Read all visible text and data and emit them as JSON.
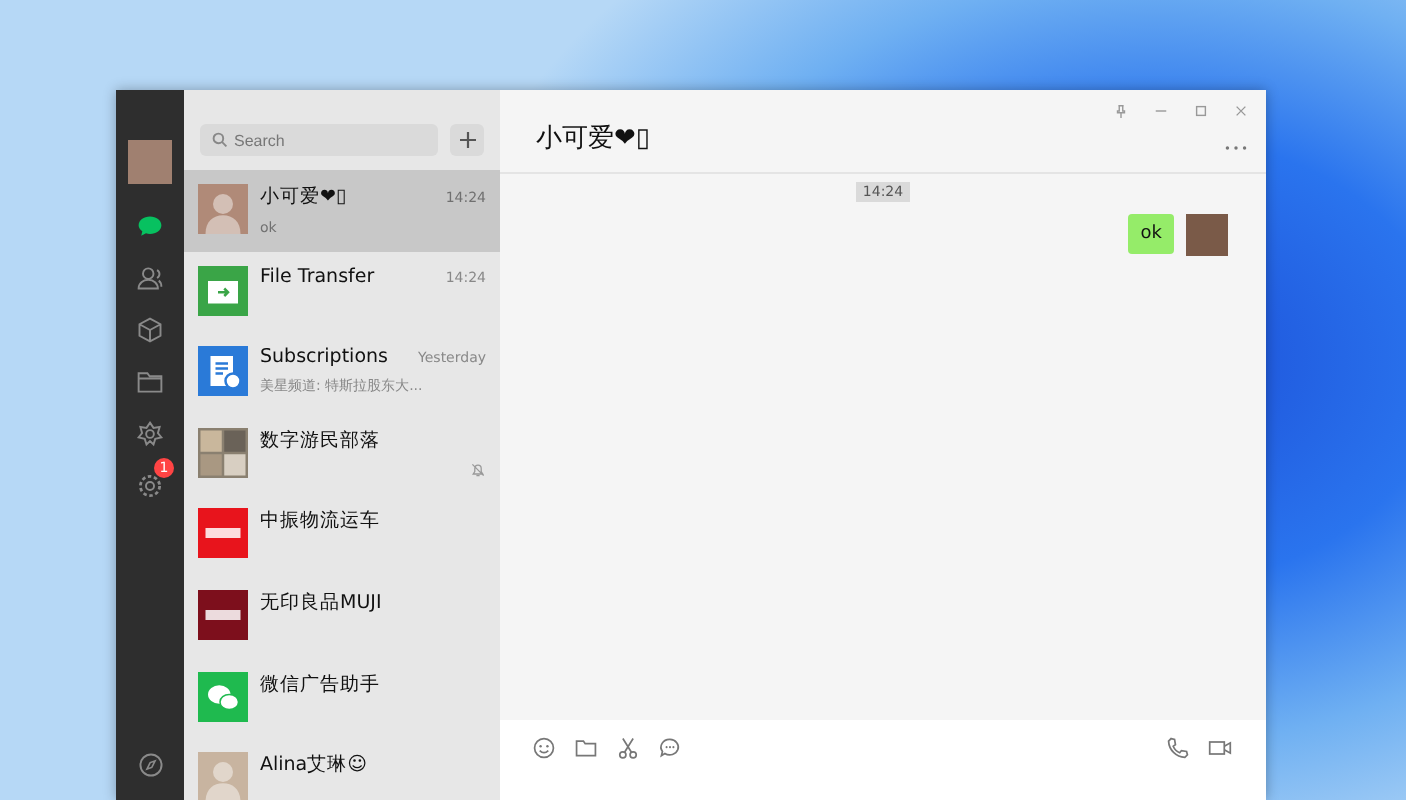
{
  "window": {
    "title": "小可爱❤▯"
  },
  "sidebar": {
    "items": [
      {
        "kind": "chats",
        "selected": true
      },
      {
        "kind": "contacts",
        "selected": false
      },
      {
        "kind": "cube",
        "selected": false
      },
      {
        "kind": "folder",
        "selected": false
      },
      {
        "kind": "flower",
        "selected": false
      },
      {
        "kind": "settings",
        "selected": false,
        "badge": "1"
      }
    ]
  },
  "search": {
    "placeholder": "Search"
  },
  "chats": [
    {
      "name": "小可爱❤▯",
      "preview": "ok",
      "time": "14:24",
      "selected": true,
      "muted": false,
      "kind": "photo",
      "color": "#b08a78"
    },
    {
      "name": "File Transfer",
      "time": "14:24",
      "selected": false,
      "muted": false,
      "kind": "file",
      "color": "#3aa547"
    },
    {
      "name": "Subscriptions",
      "preview": "美星频道: 特斯拉股东大...",
      "time": "Yesterday",
      "selected": false,
      "muted": false,
      "kind": "doc",
      "color": "#2a7ad8"
    },
    {
      "name": "数字游民部落",
      "selected": false,
      "muted": true,
      "kind": "group",
      "color": "#8a8070"
    },
    {
      "name": "中振物流运车",
      "selected": false,
      "muted": false,
      "kind": "logo",
      "color": "#e8141c"
    },
    {
      "name": "无印良品MUJI",
      "selected": false,
      "muted": false,
      "kind": "logo",
      "color": "#7d0f1c"
    },
    {
      "name": "微信广告助手",
      "selected": false,
      "muted": false,
      "kind": "wechat",
      "color": "#1fba4f"
    },
    {
      "name": "Alina艾琳☺",
      "selected": false,
      "muted": false,
      "kind": "photo",
      "color": "#c8b4a0"
    }
  ],
  "conversation": {
    "timestamp": "14:24",
    "messages": [
      {
        "text": "ok",
        "outgoing": true
      }
    ]
  }
}
